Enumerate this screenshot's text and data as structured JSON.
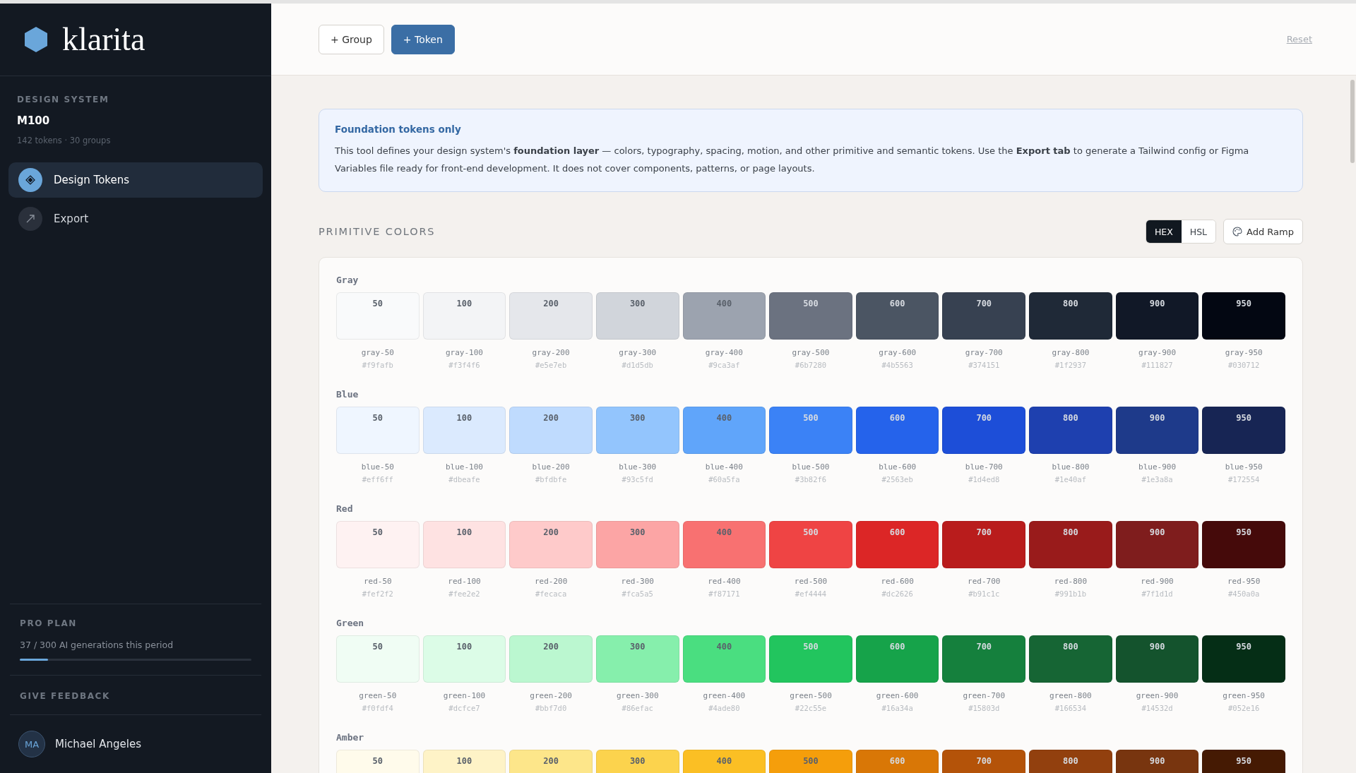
{
  "sidebar": {
    "logo": "klarita",
    "section_label": "DESIGN SYSTEM",
    "system_name": "M100",
    "stats": "142 tokens · 30 groups",
    "nav": [
      {
        "label": "Design Tokens",
        "kind": "tokens",
        "selected": true
      },
      {
        "label": "Export",
        "kind": "export",
        "selected": false
      }
    ],
    "plan": {
      "label": "PRO PLAN",
      "usage": "37 / 300 AI generations this period",
      "level": 0.123
    },
    "feedback": "GIVE FEEDBACK",
    "user": {
      "initials": "MA",
      "name": "Michael Angeles"
    }
  },
  "toolbar": {
    "buttons": [
      {
        "label": "+ Group",
        "kind": "outline"
      },
      {
        "label": "+ Token",
        "kind": "primary"
      }
    ],
    "reset": "Reset"
  },
  "notice": {
    "title": "Foundation tokens only",
    "body": "This tool defines your design system's **foundation layer** — colors, typography, spacing, motion, and other primitive and semantic tokens. Use the **Export tab** to generate a Tailwind config or Figma Variables file ready for front-end development. It does not cover components, patterns, or page layouts."
  },
  "primitive_colors": {
    "title": "PRIMITIVE COLORS",
    "formats": [
      {
        "label": "HEX",
        "selected": true
      },
      {
        "label": "HSL",
        "selected": false
      }
    ],
    "add_button": "Add Ramp",
    "ramps": [
      {
        "name": "Gray",
        "swatches": [
          {
            "step": "50",
            "name": "gray-50",
            "hex": "#f9fafb",
            "color": "#f9fafb"
          },
          {
            "step": "100",
            "name": "gray-100",
            "hex": "#f3f4f6",
            "color": "#f3f4f6"
          },
          {
            "step": "200",
            "name": "gray-200",
            "hex": "#e5e7eb",
            "color": "#e5e7eb"
          },
          {
            "step": "300",
            "name": "gray-300",
            "hex": "#d1d5db",
            "color": "#d1d5db"
          },
          {
            "step": "400",
            "name": "gray-400",
            "hex": "#9ca3af",
            "color": "#9ca3af"
          },
          {
            "step": "500",
            "name": "gray-500",
            "hex": "#6b7280",
            "color": "#6b7280"
          },
          {
            "step": "600",
            "name": "gray-600",
            "hex": "#4b5563",
            "color": "#4b5563"
          },
          {
            "step": "700",
            "name": "gray-700",
            "hex": "#374151",
            "color": "#374151"
          },
          {
            "step": "800",
            "name": "gray-800",
            "hex": "#1f2937",
            "color": "#1f2937"
          },
          {
            "step": "900",
            "name": "gray-900",
            "hex": "#111827",
            "color": "#111827"
          },
          {
            "step": "950",
            "name": "gray-950",
            "hex": "#030712",
            "color": "#030712"
          }
        ]
      },
      {
        "name": "Blue",
        "swatches": [
          {
            "step": "50",
            "name": "blue-50",
            "hex": "#eff6ff",
            "color": "#eff6ff"
          },
          {
            "step": "100",
            "name": "blue-100",
            "hex": "#dbeafe",
            "color": "#dbeafe"
          },
          {
            "step": "200",
            "name": "blue-200",
            "hex": "#bfdbfe",
            "color": "#bfdbfe"
          },
          {
            "step": "300",
            "name": "blue-300",
            "hex": "#93c5fd",
            "color": "#93c5fd"
          },
          {
            "step": "400",
            "name": "blue-400",
            "hex": "#60a5fa",
            "color": "#60a5fa"
          },
          {
            "step": "500",
            "name": "blue-500",
            "hex": "#3b82f6",
            "color": "#3b82f6"
          },
          {
            "step": "600",
            "name": "blue-600",
            "hex": "#2563eb",
            "color": "#2563eb"
          },
          {
            "step": "700",
            "name": "blue-700",
            "hex": "#1d4ed8",
            "color": "#1d4ed8"
          },
          {
            "step": "800",
            "name": "blue-800",
            "hex": "#1e40af",
            "color": "#1e40af"
          },
          {
            "step": "900",
            "name": "blue-900",
            "hex": "#1e3a8a",
            "color": "#1e3a8a"
          },
          {
            "step": "950",
            "name": "blue-950",
            "hex": "#172554",
            "color": "#172554"
          }
        ]
      },
      {
        "name": "Red",
        "swatches": [
          {
            "step": "50",
            "name": "red-50",
            "hex": "#fef2f2",
            "color": "#fef2f2"
          },
          {
            "step": "100",
            "name": "red-100",
            "hex": "#fee2e2",
            "color": "#fee2e2"
          },
          {
            "step": "200",
            "name": "red-200",
            "hex": "#fecaca",
            "color": "#fecaca"
          },
          {
            "step": "300",
            "name": "red-300",
            "hex": "#fca5a5",
            "color": "#fca5a5"
          },
          {
            "step": "400",
            "name": "red-400",
            "hex": "#f87171",
            "color": "#f87171"
          },
          {
            "step": "500",
            "name": "red-500",
            "hex": "#ef4444",
            "color": "#ef4444"
          },
          {
            "step": "600",
            "name": "red-600",
            "hex": "#dc2626",
            "color": "#dc2626"
          },
          {
            "step": "700",
            "name": "red-700",
            "hex": "#b91c1c",
            "color": "#b91c1c"
          },
          {
            "step": "800",
            "name": "red-800",
            "hex": "#991b1b",
            "color": "#991b1b"
          },
          {
            "step": "900",
            "name": "red-900",
            "hex": "#7f1d1d",
            "color": "#7f1d1d"
          },
          {
            "step": "950",
            "name": "red-950",
            "hex": "#450a0a",
            "color": "#450a0a"
          }
        ]
      },
      {
        "name": "Green",
        "swatches": [
          {
            "step": "50",
            "name": "green-50",
            "hex": "#f0fdf4",
            "color": "#f0fdf4"
          },
          {
            "step": "100",
            "name": "green-100",
            "hex": "#dcfce7",
            "color": "#dcfce7"
          },
          {
            "step": "200",
            "name": "green-200",
            "hex": "#bbf7d0",
            "color": "#bbf7d0"
          },
          {
            "step": "300",
            "name": "green-300",
            "hex": "#86efac",
            "color": "#86efac"
          },
          {
            "step": "400",
            "name": "green-400",
            "hex": "#4ade80",
            "color": "#4ade80"
          },
          {
            "step": "500",
            "name": "green-500",
            "hex": "#22c55e",
            "color": "#22c55e"
          },
          {
            "step": "600",
            "name": "green-600",
            "hex": "#16a34a",
            "color": "#16a34a"
          },
          {
            "step": "700",
            "name": "green-700",
            "hex": "#15803d",
            "color": "#15803d"
          },
          {
            "step": "800",
            "name": "green-800",
            "hex": "#166534",
            "color": "#166534"
          },
          {
            "step": "900",
            "name": "green-900",
            "hex": "#14532d",
            "color": "#14532d"
          },
          {
            "step": "950",
            "name": "green-950",
            "hex": "#052e16",
            "color": "#052e16"
          }
        ]
      },
      {
        "name": "Amber",
        "swatches": [
          {
            "step": "50",
            "color": "#fffbeb"
          },
          {
            "step": "100",
            "color": "#fef3c7"
          },
          {
            "step": "200",
            "color": "#fde68a"
          },
          {
            "step": "300",
            "color": "#fcd34d"
          },
          {
            "step": "400",
            "color": "#fbbf24"
          },
          {
            "step": "500",
            "color": "#f59e0b"
          },
          {
            "step": "600",
            "color": "#d97706"
          },
          {
            "step": "700",
            "color": "#b45309"
          },
          {
            "step": "800",
            "color": "#92400e"
          },
          {
            "step": "900",
            "color": "#78350f"
          },
          {
            "step": "950",
            "color": "#451a03"
          }
        ]
      }
    ]
  }
}
